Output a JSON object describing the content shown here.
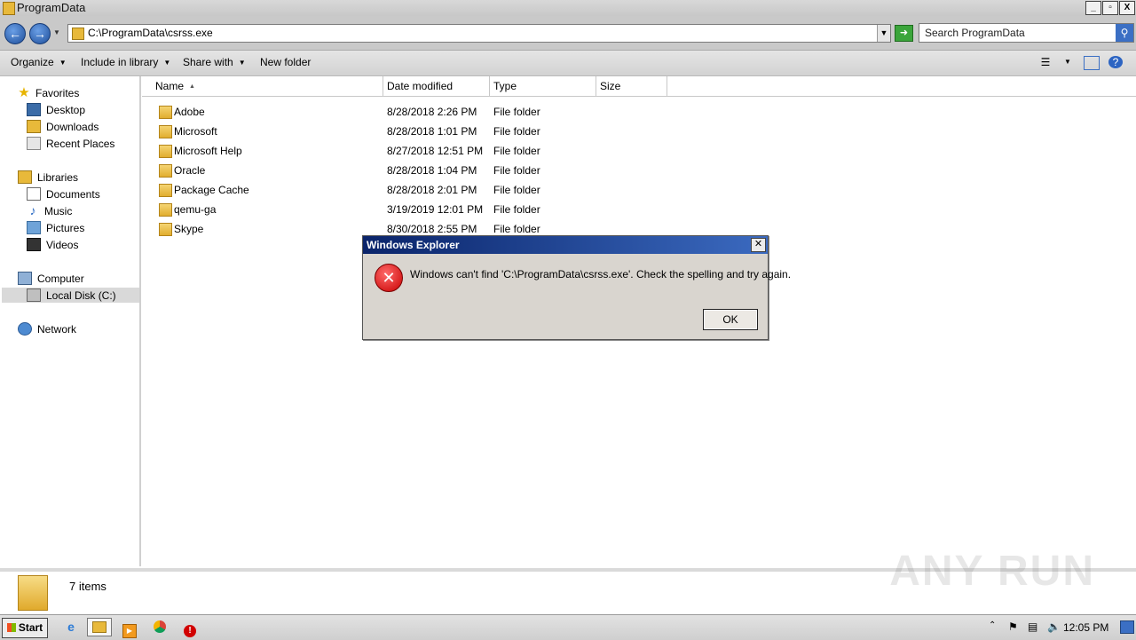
{
  "window": {
    "title": "ProgramData",
    "buttons": [
      "_",
      "▫",
      "X"
    ]
  },
  "address_bar": {
    "path": "C:\\ProgramData\\csrss.exe"
  },
  "search": {
    "placeholder": "Search ProgramData"
  },
  "toolbar": {
    "organize": "Organize",
    "include_in_library": "Include in library",
    "share_with": "Share with",
    "new_folder": "New folder"
  },
  "nav_pane": {
    "favorites": "Favorites",
    "desktop": "Desktop",
    "downloads": "Downloads",
    "recent_places": "Recent Places",
    "libraries": "Libraries",
    "documents": "Documents",
    "music": "Music",
    "pictures": "Pictures",
    "videos": "Videos",
    "computer": "Computer",
    "local_disk": "Local Disk (C:)",
    "network": "Network"
  },
  "columns": {
    "name": "Name",
    "date_modified": "Date modified",
    "type": "Type",
    "size": "Size"
  },
  "files": [
    {
      "name": "Adobe",
      "date": "8/28/2018 2:26 PM",
      "type": "File folder"
    },
    {
      "name": "Microsoft",
      "date": "8/28/2018 1:01 PM",
      "type": "File folder"
    },
    {
      "name": "Microsoft Help",
      "date": "8/27/2018 12:51 PM",
      "type": "File folder"
    },
    {
      "name": "Oracle",
      "date": "8/28/2018 1:04 PM",
      "type": "File folder"
    },
    {
      "name": "Package Cache",
      "date": "8/28/2018 2:01 PM",
      "type": "File folder"
    },
    {
      "name": "qemu-ga",
      "date": "3/19/2019 12:01 PM",
      "type": "File folder"
    },
    {
      "name": "Skype",
      "date": "8/30/2018 2:55 PM",
      "type": "File folder"
    }
  ],
  "status": {
    "count": "7 items"
  },
  "watermark": "ANY RUN",
  "dialog": {
    "title": "Windows Explorer",
    "message": "Windows can't find 'C:\\ProgramData\\csrss.exe'.  Check the spelling and try again.",
    "ok_label": "OK"
  },
  "taskbar": {
    "start_label": "Start",
    "clock": "12:05 PM"
  },
  "colors": {
    "dialog_title": "#0a246a",
    "error": "#c80000",
    "folder": "#e8b93a"
  }
}
